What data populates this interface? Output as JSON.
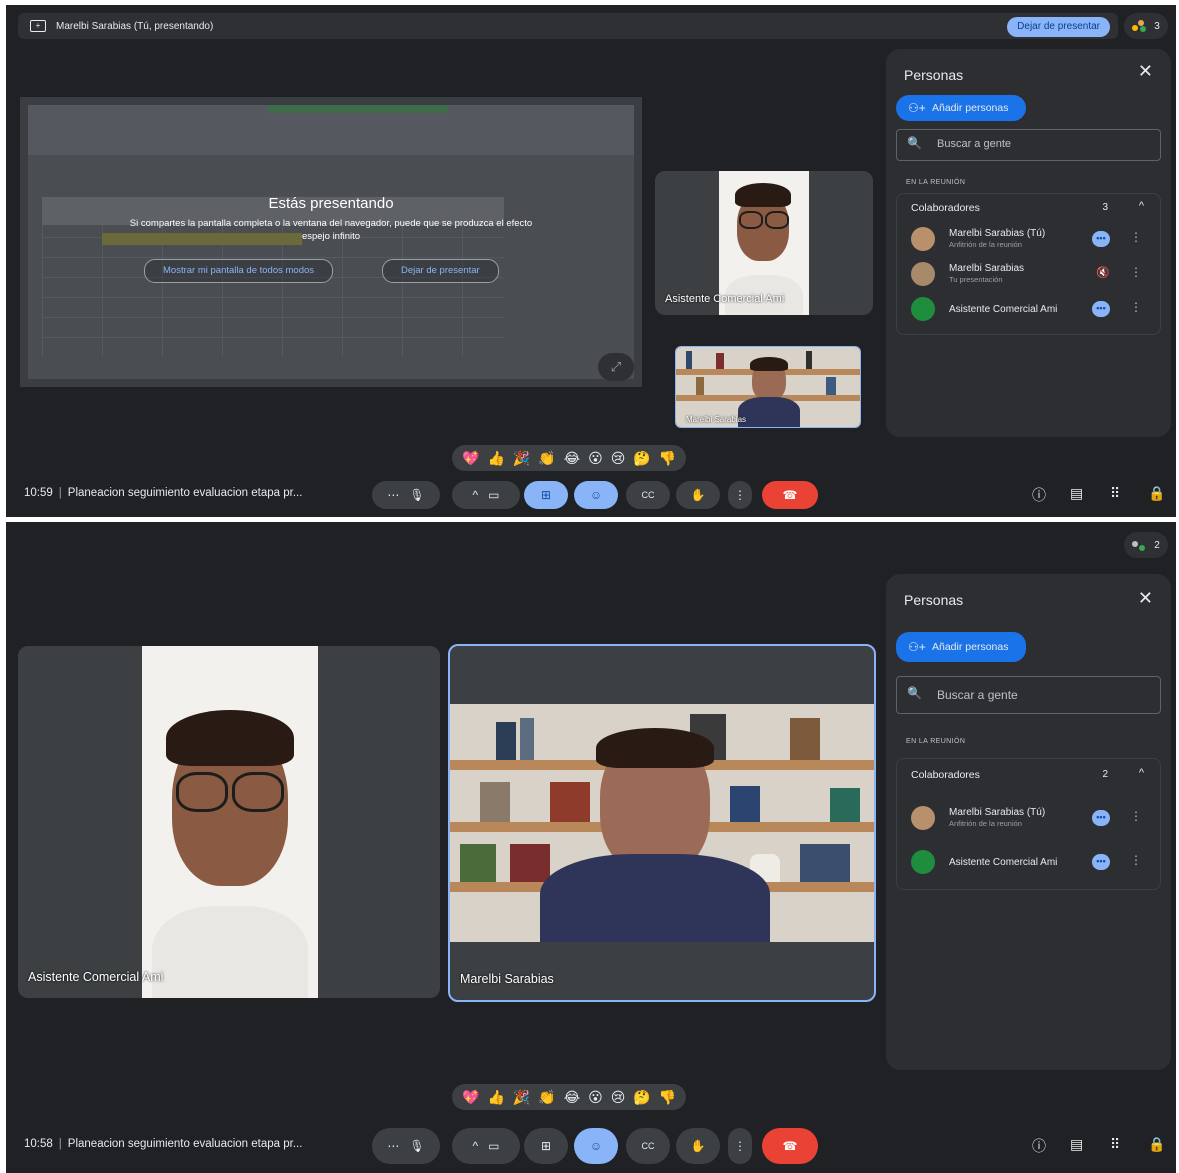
{
  "screen1": {
    "presenting_bar": "Marelbi Sarabias (Tú, presentando)",
    "stop_presenting": "Dejar de presentar",
    "participant_count": "3",
    "presentation": {
      "title": "Estás presentando",
      "warning": "Si compartes la pantalla completa o la ventana del navegador, puede que se produzca el efecto espejo infinito",
      "show_anyway": "Mostrar mi pantalla de todos modos",
      "stop": "Dejar de presentar"
    },
    "tile_main_name": "Asistente Comercial Ami",
    "tile_self_name": "Marelbi Sarabias",
    "time": "10:59",
    "meeting_title": "Planeacion seguimiento evaluacion etapa pr...",
    "panel": {
      "title": "Personas",
      "add": "Añadir personas",
      "search_placeholder": "Buscar a gente",
      "in_meeting": "EN LA REUNIÓN",
      "group": "Colaboradores",
      "group_count": "3",
      "people": [
        {
          "name": "Marelbi Sarabias (Tú)",
          "sub": "Anfitrión de la reunión"
        },
        {
          "name": "Marelbi Sarabias",
          "sub": "Tu presentación"
        },
        {
          "name": "Asistente Comercial Ami",
          "sub": ""
        }
      ]
    }
  },
  "screen2": {
    "participant_count": "2",
    "tile_left_name": "Asistente Comercial Ami",
    "tile_right_name": "Marelbi Sarabias",
    "time": "10:58",
    "meeting_title": "Planeacion seguimiento evaluacion etapa pr...",
    "panel": {
      "title": "Personas",
      "add": "Añadir personas",
      "search_placeholder": "Buscar a gente",
      "in_meeting": "EN LA REUNIÓN",
      "group": "Colaboradores",
      "group_count": "2",
      "people": [
        {
          "name": "Marelbi Sarabias (Tú)",
          "sub": "Anfitrión de la reunión"
        },
        {
          "name": "Asistente Comercial Ami",
          "sub": ""
        }
      ]
    }
  },
  "reactions": [
    "💖",
    "👍",
    "🎉",
    "👏",
    "😂",
    "😮",
    "😢",
    "🤔",
    "👎"
  ],
  "icons": {
    "more": "⋯",
    "mic": "🎙",
    "caret": "^",
    "camera": "▭",
    "present": "⊞",
    "emoji": "☺",
    "cc": "CC",
    "hand": "✋",
    "options": "⋮",
    "end": "☎",
    "info": "ⓘ",
    "chat": "▤",
    "apps": "⠿",
    "lock": "🔒"
  },
  "colors": {
    "accent": "#8ab4f8",
    "end_call": "#ea4335",
    "background": "#202124",
    "add_button": "#1a73e8"
  }
}
